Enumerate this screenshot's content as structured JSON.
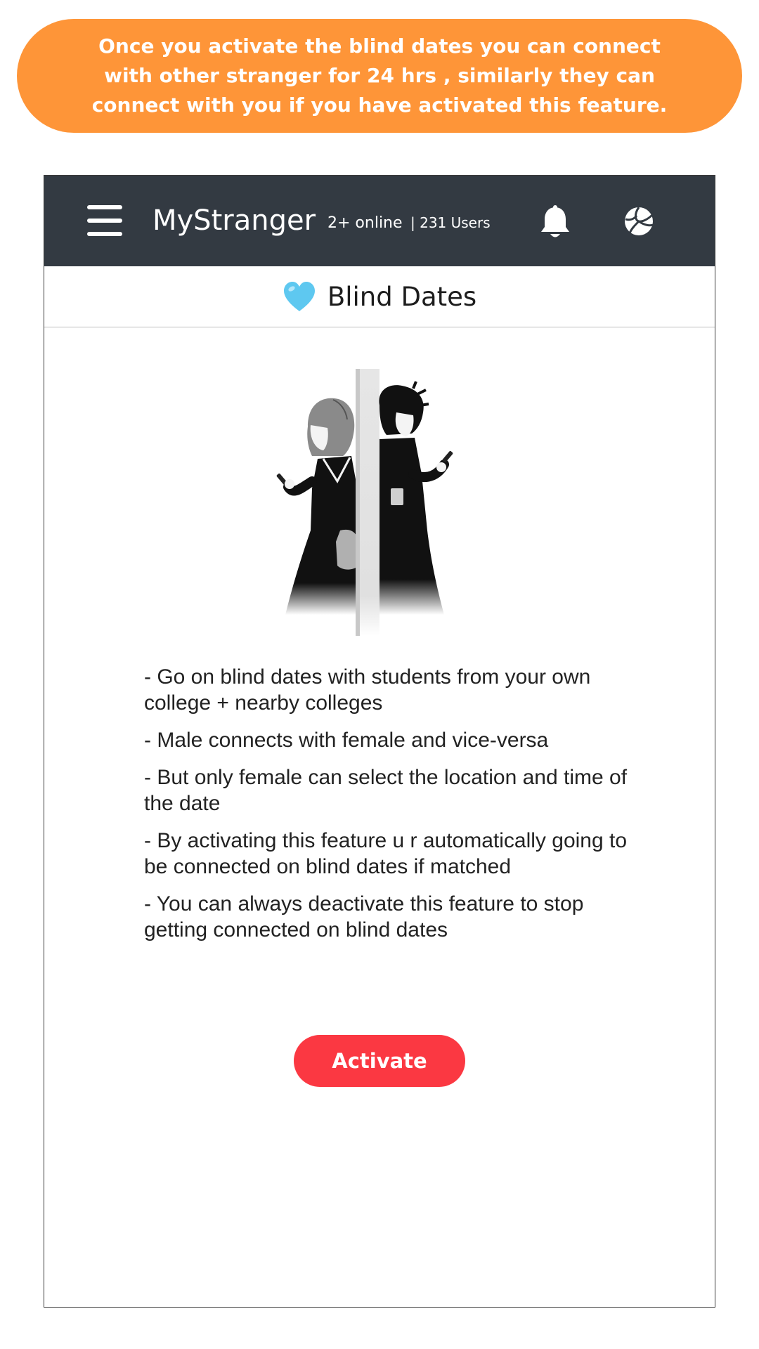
{
  "banner": {
    "text": "Once you activate the blind dates you can connect with other stranger for 24 hrs , similarly they can connect with you if you have activated this feature."
  },
  "navbar": {
    "brand": "MyStranger",
    "online": "2+ online",
    "users": "| 231 Users",
    "icons": [
      "menu-icon",
      "bell-icon",
      "volleyball-icon"
    ]
  },
  "page": {
    "title": "Blind Dates",
    "title_icon": "light-blue-heart-icon"
  },
  "info": {
    "bullets": [
      "- Go on blind dates with students from your own college + nearby colleges",
      "- Male connects with female and vice-versa",
      "- But only female can select the location and time of the date",
      "- By activating this feature u r automatically going to be connected on blind dates if matched",
      "- You can always deactivate this feature to stop getting connected on blind dates"
    ]
  },
  "actions": {
    "activate_label": "Activate"
  },
  "colors": {
    "banner": "#fe9538",
    "navbar": "#333a42",
    "activate": "#fb3842",
    "heart": "#5ec8f0"
  }
}
